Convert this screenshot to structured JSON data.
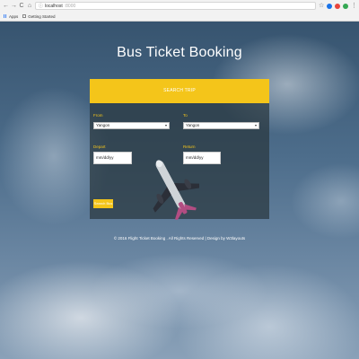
{
  "browser": {
    "nav_back": "←",
    "nav_forward": "→",
    "nav_reload": "C",
    "nav_home": "⌂",
    "url_host": "localhost",
    "url_port": ":8000",
    "bookmarks": [
      {
        "label": "Apps",
        "icon": "apps-grid-icon"
      },
      {
        "label": "Getting Started",
        "icon": "bookmark-page-icon"
      }
    ],
    "extensions": [
      "#1a73e8",
      "#e8453c",
      "#34a853",
      "#8a8a8a"
    ]
  },
  "page": {
    "title": "Bus Ticket Booking",
    "search_trip": "SEARCH TRIP",
    "from_label": "From",
    "from_value": "Yangon",
    "to_label": "To",
    "to_value": "Yangon",
    "depart_label": "Depart",
    "depart_placeholder": "mm/dd/yy",
    "return_label": "Return",
    "return_placeholder": "mm/dd/yy",
    "search_button": "Search Bus",
    "footer": "© 2016 Flight Ticket Booking . All Rights Reserved | Design by W3layouts"
  },
  "colors": {
    "accent": "#f4c51a",
    "panel": "rgba(42,55,62,0.72)"
  }
}
